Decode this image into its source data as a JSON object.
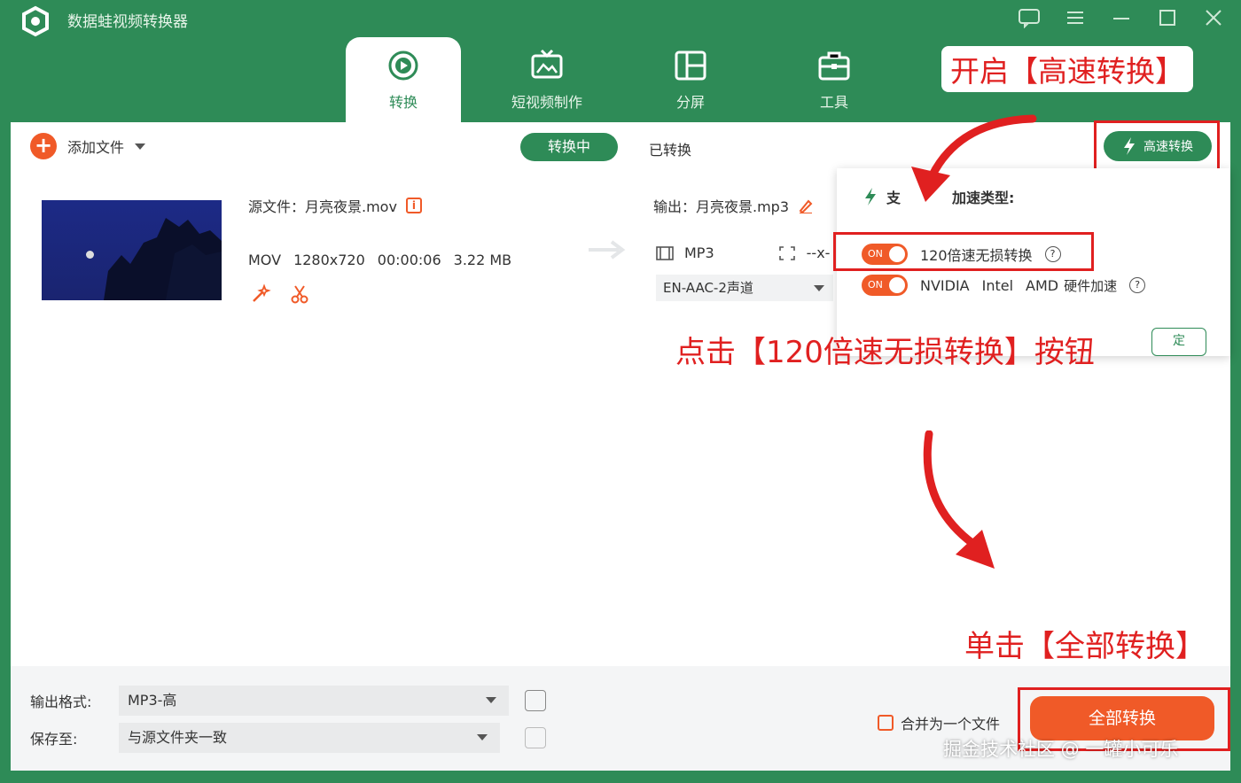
{
  "app": {
    "title": "数据蛙视频转换器"
  },
  "tabs": [
    {
      "label": "转换",
      "icon": "convert-icon"
    },
    {
      "label": "短视频制作",
      "icon": "tv-icon"
    },
    {
      "label": "分屏",
      "icon": "split-screen-icon"
    },
    {
      "label": "工具",
      "icon": "toolbox-icon"
    }
  ],
  "toolbar": {
    "add_file": "添加文件",
    "converting": "转换中",
    "converted": "已转换",
    "turbo": "高速转换"
  },
  "file": {
    "source_label": "源文件：月亮夜景.mov",
    "format": "MOV",
    "resolution": "1280x720",
    "duration": "00:00:06",
    "size": "3.22 MB",
    "output_label": "输出：月亮夜景.mp3",
    "output_format": "MP3",
    "output_res": "--x-",
    "audio_track": "EN-AAC-2声道"
  },
  "popup": {
    "title": "支持的加速类型:",
    "title_visible_start": "支",
    "title_visible_end": "加速类型:",
    "toggle_on": "ON",
    "option1": "120倍速无损转换",
    "option2_nvidia": "NVIDIA",
    "option2_intel": "Intel",
    "option2_amd": "AMD",
    "option2_suffix": "硬件加速",
    "apply_partial": "定"
  },
  "annotations": {
    "enable_turbo": "开启【高速转换】",
    "click_120x": "点击【120倍速无损转换】按钮",
    "click_all": "单击【全部转换】"
  },
  "bottom": {
    "output_format_label": "输出格式:",
    "output_format_value": "MP3-高",
    "save_to_label": "保存至:",
    "save_to_value": "与源文件夹一致",
    "merge_label": "合并为一个文件",
    "convert_all": "全部转换"
  },
  "watermark": "掘金技术社区 @ 一罐小可乐",
  "colors": {
    "brand_green": "#2e8b57",
    "accent_orange": "#f05a28",
    "annotation_red": "#e02020"
  }
}
